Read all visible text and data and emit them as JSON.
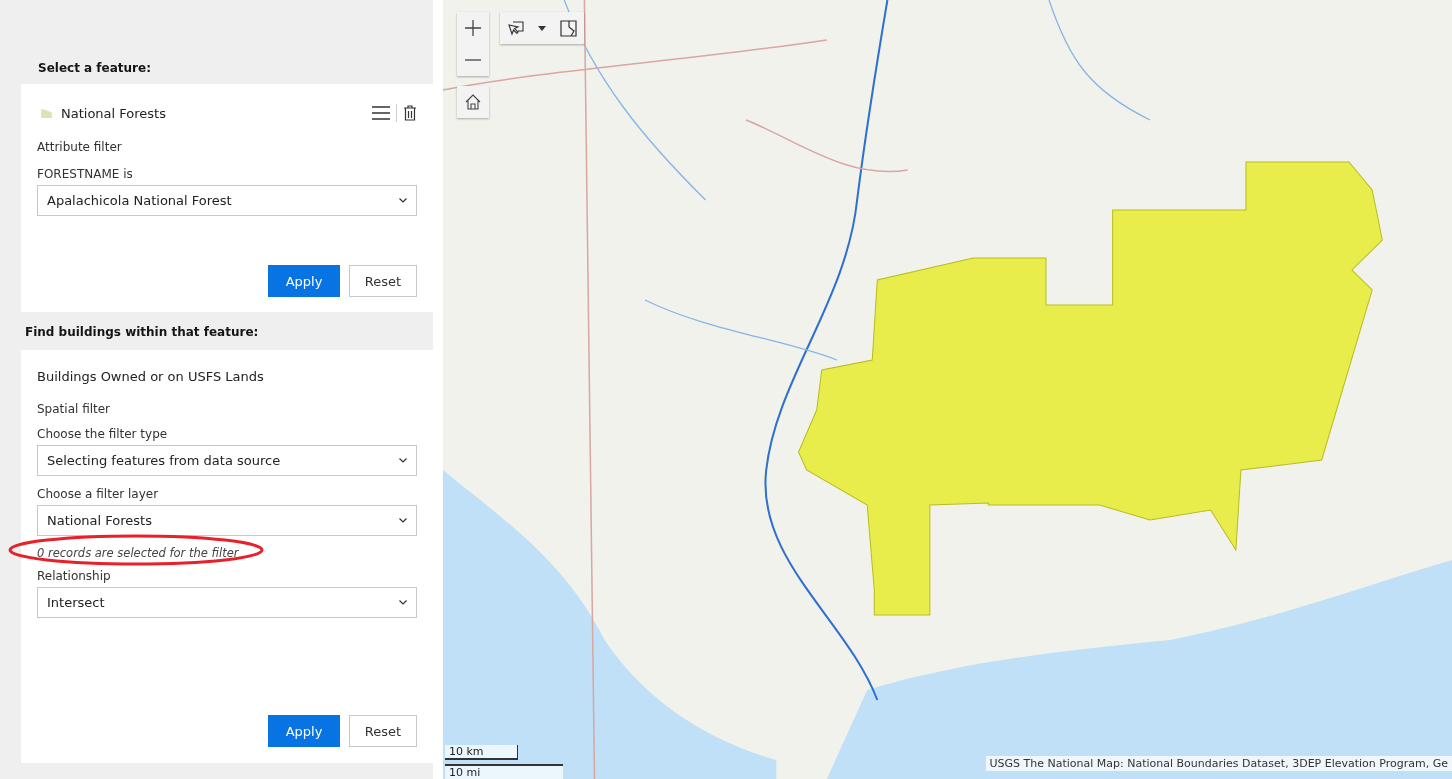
{
  "feature_section": {
    "heading": "Select a feature:",
    "layer": {
      "name": "National Forests"
    },
    "filter_title": "Attribute filter",
    "field_label": "FORESTNAME is",
    "field_value": "Apalachicola National Forest",
    "buttons": [
      "Apply",
      "Reset"
    ]
  },
  "buildings_section": {
    "heading": "Find buildings within that feature:",
    "layer_name": "Buildings Owned or on USFS Lands",
    "filter_title": "Spatial filter",
    "fields": [
      {
        "label": "Choose the filter type",
        "value": "Selecting features from data source"
      },
      {
        "label": "Choose a filter layer",
        "value": "National Forests",
        "note": "0 records are selected for the filter"
      },
      {
        "label": "Relationship",
        "value": "Intersect"
      }
    ],
    "buttons": [
      "Apply",
      "Reset"
    ]
  },
  "map": {
    "scale": [
      "10 km",
      "10 mi"
    ],
    "attribution": "USGS The National Map: National Boundaries Dataset, 3DEP Elevation Program, Ge"
  }
}
